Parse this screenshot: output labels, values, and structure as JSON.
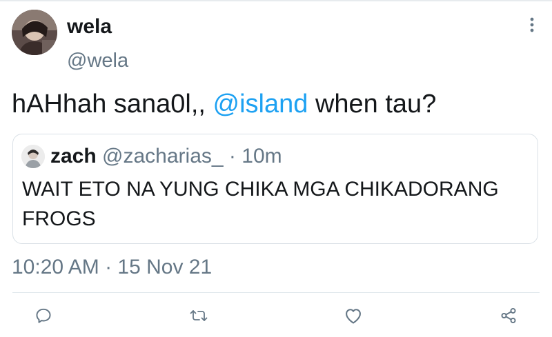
{
  "tweet": {
    "author": {
      "display_name": "wela",
      "username": "@wela"
    },
    "text_before": "hAHhah sana0l,, ",
    "mention": "@island",
    "text_after": " when tau?",
    "timestamp": "10:20 AM · 15 Nov 21"
  },
  "quoted_tweet": {
    "author_name": "zach",
    "username": "@zacharias_",
    "separator": " · ",
    "time": "10m",
    "text": "WAIT ETO NA YUNG CHIKA MGA CHIKADORANG FROGS"
  },
  "icons": {
    "more": "more-vertical-icon",
    "reply": "reply-icon",
    "retweet": "retweet-icon",
    "like": "heart-icon",
    "share": "share-icon"
  },
  "colors": {
    "mention": "#1da1f2",
    "secondary_text": "#657786",
    "primary_text": "#14171a",
    "border": "#d9e0e6"
  }
}
